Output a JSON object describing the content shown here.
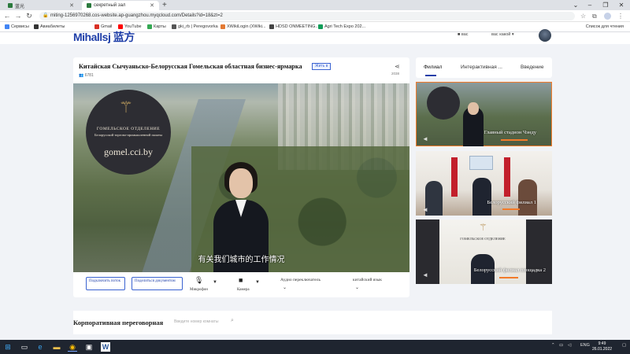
{
  "browser": {
    "tabs": [
      {
        "title": "蓝光",
        "active": false
      },
      {
        "title": "секретный зал",
        "active": true
      }
    ],
    "new_tab": "+",
    "window_controls": [
      "⌄",
      "–",
      "❐",
      "✕"
    ],
    "url": "miting-1256970268.cos-website.ap-guangzhou.myqcloud.com/Details?id=18&zt=2",
    "bookmarks": [
      {
        "label": "Сервисы",
        "icon": "apps-icon",
        "color": "#4285f4"
      },
      {
        "label": "Авиабилеты",
        "icon": "plane-icon",
        "color": "#333333"
      },
      {
        "label": "Gmail",
        "icon": "gmail-icon",
        "color": "#d93025"
      },
      {
        "label": "YouTube",
        "icon": "youtube-icon",
        "color": "#ff0000"
      },
      {
        "label": "Карты",
        "icon": "maps-icon",
        "color": "#34a853"
      },
      {
        "label": "gki_rb | Peregovorka",
        "icon": "page-icon",
        "color": "#555555"
      },
      {
        "label": "XWikiLogin (XWiki...",
        "icon": "xwiki-icon",
        "color": "#e37933"
      },
      {
        "label": "HDSD ONMEETING...",
        "icon": "page-icon",
        "color": "#444444"
      },
      {
        "label": "Agri Tech Expo 202...",
        "icon": "page-icon",
        "color": "#0f9d58"
      }
    ],
    "bookmarks_right": "Список для чтения"
  },
  "site": {
    "logo": "Mihallsj 蓝方",
    "header_links": [
      "■ вас",
      "вас какой ▾"
    ]
  },
  "meeting": {
    "title": "Китайская Сычуаньско-Белорусская Гомельская областная бизнес-ярмарка",
    "status_badge": "Жить в",
    "viewers": "6781",
    "share_count": "2038",
    "video": {
      "emblem_line1": "ГОМЕЛЬСКОЕ ОТДЕЛЕНИЕ",
      "emblem_line2": "Белорусской торгово-промышленной палаты",
      "emblem_line3": "gomel.cci.by",
      "subtitle": "有关我们城市的工作情况"
    },
    "controls": {
      "connect_stream": "Подключить поток",
      "share_docs": "Поделиться документом",
      "microphone": "Микрофон",
      "camera": "Камера",
      "audio_switch": "Аудио переключатель",
      "language": "китайский язык"
    }
  },
  "side_panel": {
    "tabs": [
      "Филиал",
      "Интерактивная ...",
      "Введение"
    ],
    "active_tab": 0,
    "thumbnails": [
      {
        "caption": "Главный стадион Чэнду",
        "selected": true
      },
      {
        "caption": "Белорусский филиал 1",
        "selected": false
      },
      {
        "caption": "Белорусский филиал площадка 2",
        "selected": false
      }
    ]
  },
  "bottom": {
    "title": "Корпоративная переговорная",
    "search_placeholder": "Введите номер комнаты"
  },
  "taskbar": {
    "language": "ENG",
    "time": "9:49",
    "date": "26.01.2022"
  }
}
